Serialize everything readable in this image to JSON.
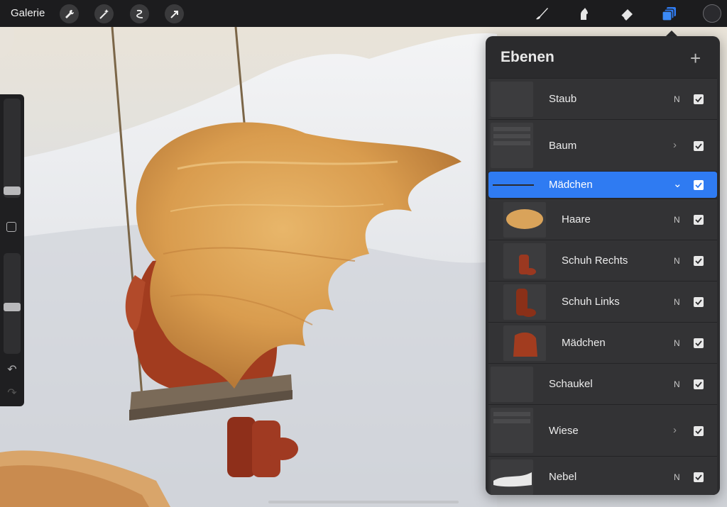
{
  "topbar": {
    "gallery_label": "Galerie",
    "left_tools": [
      "wrench-icon",
      "magic-wand-icon",
      "selection-icon",
      "transform-arrow-icon"
    ],
    "right_tools": [
      "brush-icon",
      "smudge-icon",
      "eraser-icon",
      "layers-icon"
    ],
    "active_tool": "layers-icon",
    "current_color": "#2a2a2e",
    "accent": "#2f7bf2"
  },
  "sidebar": {
    "brush_size_level": 0.08,
    "opacity_level": 0.45,
    "modify_button": "square-icon",
    "undo": "undo-icon",
    "redo": "redo-icon"
  },
  "layers_panel": {
    "title": "Ebenen",
    "add_button": "+",
    "layers": [
      {
        "name": "Staub",
        "mode": "N",
        "visible": true
      },
      {
        "name": "Baum",
        "group": true,
        "expanded": false,
        "visible": true
      },
      {
        "name": "Mädchen",
        "group": true,
        "expanded": true,
        "selected": true,
        "visible": true
      },
      {
        "name": "Haare",
        "mode": "N",
        "visible": true,
        "child": true
      },
      {
        "name": "Schuh Rechts",
        "mode": "N",
        "visible": true,
        "child": true
      },
      {
        "name": "Schuh Links",
        "mode": "N",
        "visible": true,
        "child": true
      },
      {
        "name": "Mädchen",
        "mode": "N",
        "visible": true,
        "child": true
      },
      {
        "name": "Schaukel",
        "mode": "N",
        "visible": true
      },
      {
        "name": "Wiese",
        "group": true,
        "expanded": false,
        "visible": true
      },
      {
        "name": "Nebel",
        "mode": "N",
        "visible": true
      }
    ]
  }
}
